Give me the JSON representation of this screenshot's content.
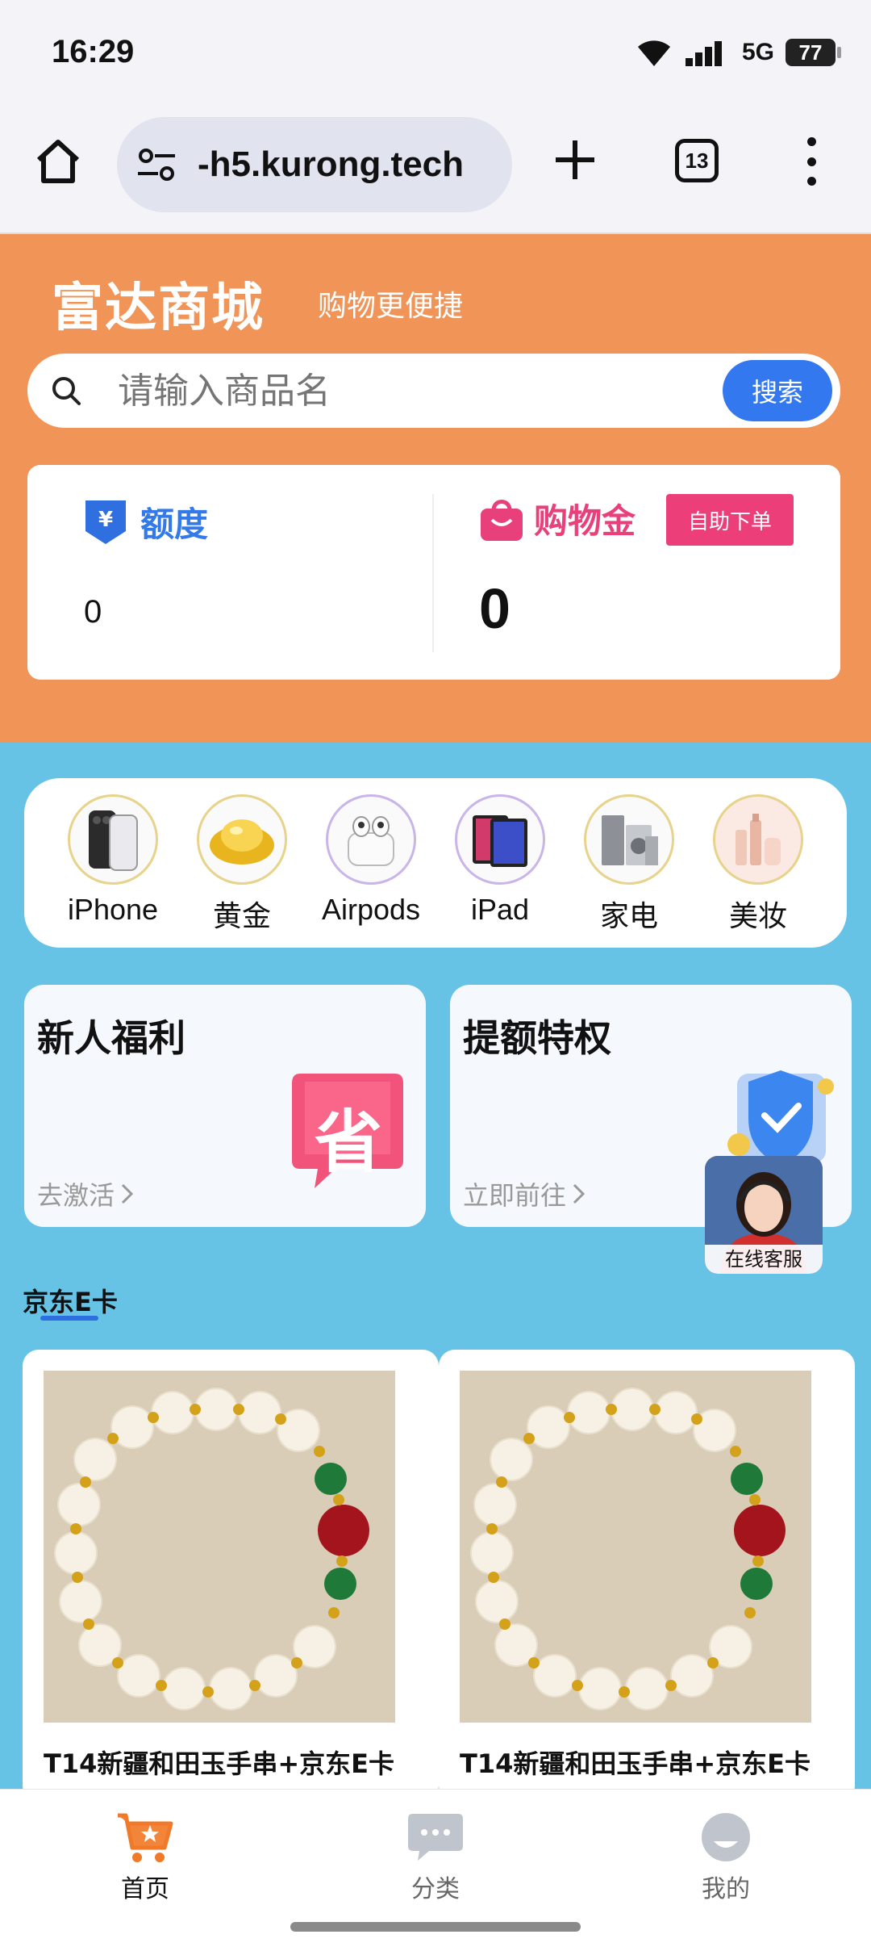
{
  "status_bar": {
    "time": "16:29",
    "network": "5G",
    "battery": "77"
  },
  "browser": {
    "url": "-h5.kurong.tech",
    "tab_count": "13"
  },
  "header": {
    "brand": "富达商城",
    "slogan": "购物更便捷"
  },
  "search": {
    "placeholder": "请输入商品名",
    "button": "搜索"
  },
  "account": {
    "quota_label": "额度",
    "quota_value": "0",
    "gold_label": "购物金",
    "gold_value": "0",
    "self_order": "自助下单"
  },
  "categories": [
    {
      "label": "iPhone",
      "icon": "iphone-icon"
    },
    {
      "label": "黄金",
      "icon": "gold-icon"
    },
    {
      "label": "Airpods",
      "icon": "airpods-icon"
    },
    {
      "label": "iPad",
      "icon": "ipad-icon"
    },
    {
      "label": "家电",
      "icon": "appliance-icon"
    },
    {
      "label": "美妆",
      "icon": "cosmetics-icon"
    }
  ],
  "promos": [
    {
      "title": "新人福利",
      "link": "去激活",
      "badge": "省"
    },
    {
      "title": "提额特权",
      "link": "立即前往"
    }
  ],
  "support": {
    "label": "在线客服"
  },
  "section": {
    "title": "京东E卡"
  },
  "products": [
    {
      "name": "T14新疆和田玉手串+京东E卡"
    },
    {
      "name": "T14新疆和田玉手串+京东E卡"
    }
  ],
  "bottom_nav": [
    {
      "label": "首页",
      "active": true
    },
    {
      "label": "分类",
      "active": false
    },
    {
      "label": "我的",
      "active": false
    }
  ],
  "colors": {
    "header_bg": "#f09458",
    "page_bg": "#66c3e6",
    "accent_blue": "#3478f0",
    "accent_pink": "#ec3f79",
    "nav_active": "#f07a2a"
  }
}
